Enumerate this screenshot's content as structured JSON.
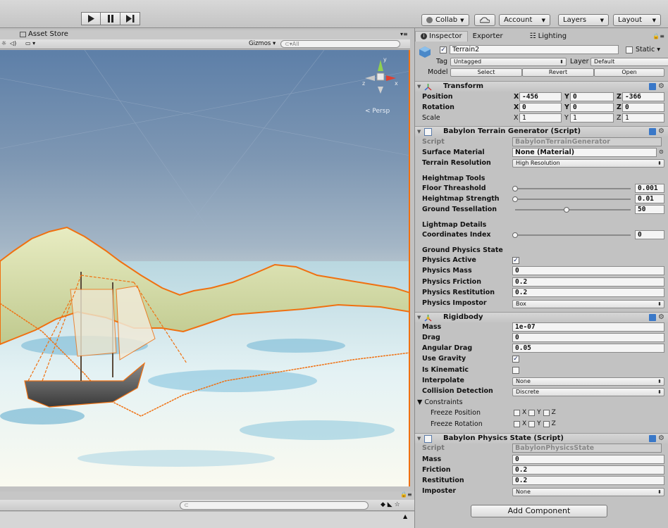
{
  "toolbar": {
    "collab": "Collab",
    "account": "Account",
    "layers": "Layers",
    "layout": "Layout"
  },
  "scene": {
    "asset_store_tab": "Asset Store",
    "gizmos": "Gizmos",
    "search_placeholder": "All",
    "persp": "Persp",
    "gizmo_axes": {
      "y": "y",
      "x": "x",
      "z": "z"
    }
  },
  "inspector": {
    "tabs": [
      "Inspector",
      "Exporter",
      "Lighting"
    ],
    "object_name": "Terrain2",
    "static_label": "Static",
    "tag_label": "Tag",
    "tag_value": "Untagged",
    "layer_label": "Layer",
    "layer_value": "Default",
    "model_label": "Model",
    "model_buttons": [
      "Select",
      "Revert",
      "Open"
    ],
    "transform": {
      "title": "Transform",
      "position_label": "Position",
      "rotation_label": "Rotation",
      "scale_label": "Scale",
      "position": {
        "x": "-456",
        "y": "0",
        "z": "-366"
      },
      "rotation": {
        "x": "0",
        "y": "0",
        "z": "0"
      },
      "scale": {
        "x": "1",
        "y": "1",
        "z": "1"
      }
    },
    "terrain_generator": {
      "title": "Babylon Terrain Generator (Script)",
      "script_label": "Script",
      "script_value": "BabylonTerrainGenerator",
      "surface_material_label": "Surface Material",
      "surface_material_value": "None (Material)",
      "terrain_resolution_label": "Terrain Resolution",
      "terrain_resolution_value": "High Resolution",
      "heightmap_tools": "Heightmap Tools",
      "floor_threshold_label": "Floor Threashold",
      "floor_threshold_value": "0.001",
      "floor_threshold_level": 0.0,
      "heightmap_strength_label": "Heightmap Strength",
      "heightmap_strength_value": "0.01",
      "heightmap_strength_level": 0.0,
      "ground_tessellation_label": "Ground Tessellation",
      "ground_tessellation_value": "50",
      "ground_tessellation_level": 0.45,
      "lightmap_details": "Lightmap Details",
      "coordinates_index_label": "Coordinates Index",
      "coordinates_index_value": "0",
      "coordinates_index_level": 0.0,
      "ground_physics_state": "Ground Physics State",
      "physics_active_label": "Physics Active",
      "physics_active": true,
      "physics_mass_label": "Physics Mass",
      "physics_mass_value": "0",
      "physics_friction_label": "Physics Friction",
      "physics_friction_value": "0.2",
      "physics_restitution_label": "Physics Restitution",
      "physics_restitution_value": "0.2",
      "physics_impostor_label": "Physics Impostor",
      "physics_impostor_value": "Box"
    },
    "rigidbody": {
      "title": "Rigidbody",
      "mass_label": "Mass",
      "mass_value": "1e-07",
      "drag_label": "Drag",
      "drag_value": "0",
      "angular_drag_label": "Angular Drag",
      "angular_drag_value": "0.05",
      "use_gravity_label": "Use Gravity",
      "use_gravity": true,
      "is_kinematic_label": "Is Kinematic",
      "is_kinematic": false,
      "interpolate_label": "Interpolate",
      "interpolate_value": "None",
      "collision_detection_label": "Collision Detection",
      "collision_detection_value": "Discrete",
      "constraints_label": "Constraints",
      "freeze_position_label": "Freeze Position",
      "freeze_rotation_label": "Freeze Rotation",
      "axis_x": "X",
      "axis_y": "Y",
      "axis_z": "Z"
    },
    "physics_state": {
      "title": "Babylon Physics State (Script)",
      "script_label": "Script",
      "script_value": "BabylonPhysicsState",
      "mass_label": "Mass",
      "mass_value": "0",
      "friction_label": "Friction",
      "friction_value": "0.2",
      "restitution_label": "Restitution",
      "restitution_value": "0.2",
      "imposter_label": "Imposter",
      "imposter_value": "None"
    },
    "add_component": "Add Component"
  },
  "colors": {
    "selection_outline": "#f07010",
    "sky_top": "#5d7fa8",
    "inspector_bg": "#c2c2c2"
  }
}
